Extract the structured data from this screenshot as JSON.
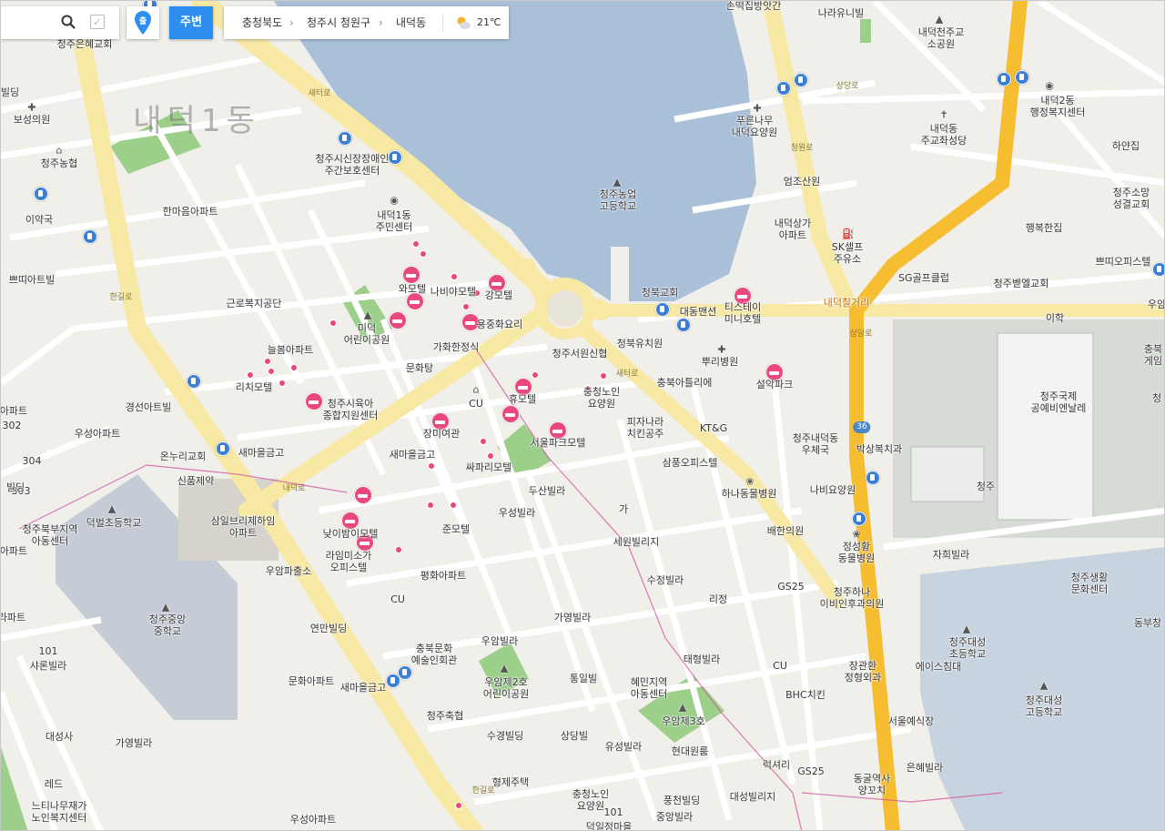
{
  "toolbar": {
    "search_icon": "search-icon",
    "checkbox_icon": "checkbox-icon",
    "pin_label": "출",
    "nearby_label": "주변",
    "breadcrumb": [
      "충청북도",
      "청주시 청원구",
      "내덕동"
    ],
    "weather_icon": "partly-cloudy-icon",
    "temperature": "21℃"
  },
  "colors": {
    "accent": "#2b8ef0",
    "motel": "#e8487e",
    "bus": "#3b7fd4",
    "highway": "#f5bd2f",
    "road_major": "#f7e9a4",
    "water": "#a9c0d8",
    "park": "#9bcf8a"
  },
  "labels": {
    "district": "내덕1동",
    "road_saetgol": "새터로",
    "road_hangul": "한길로",
    "road_naedeok": "내덕로",
    "road_cheongwon": "청원로",
    "road_sangdang": "상당로",
    "shield_36": "36",
    "cheongju_eunhye": "청주은혜교회",
    "sonteok": "손떡집방앗간",
    "narauni": "나라유니빌",
    "naedeok_cheonju_park": "내덕천주교\n소공원",
    "naedeok2_office": "내덕2동\n행정복지센터",
    "bilding": "빌딩",
    "boseong": "보성의원",
    "cheongju_nonghyup": "청주농협",
    "iyakguk": "이약국",
    "hanmaeum": "한마음아파트",
    "ppeotti": "쁘띠아트빌",
    "geunro": "근로복지공단",
    "neulbom": "늘봄아파트",
    "richi": "리치모텔",
    "gyeongseon": "경선아트빌",
    "woosung_apt": "우성아파트",
    "onnuri": "온누리교회",
    "sinpung": "신품제약",
    "saemaeul_bank1": "새마을금고",
    "a302": "302",
    "a304": "304",
    "a303": "303",
    "apt_a": "아파트",
    "bildeung": "빌딩",
    "cheongju_north_children": "청주북부지역\n아동센터",
    "deokbeol": "덕벌초등학교",
    "samil": "삼일브리제하임\n아파트",
    "uam_police": "우암파출소",
    "cheongju_middle": "청주중앙\n중학교",
    "yeonmyeon": "연만빌딩",
    "munhwa_apt": "문화아파트",
    "saemaeul_bank3": "새마을금고",
    "apt_b": "아파트",
    "sharon": "샤론빌라",
    "daeseongsa": "대성사",
    "gayeong1": "가영빌라",
    "red": "레드",
    "neutinamu": "느티나무재가\n노인복지센터",
    "cheongju_sinsijang": "청주시신장장애인\n주간보호센터",
    "naedeok1_center": "내덕1동\n주민센터",
    "wa_motel": "와모텔",
    "nabiya_motel": "나비야모텔",
    "gang_motel": "강모텔",
    "mideok_park": "미덕\n어린이공원",
    "yongjungwha": "용중화요리",
    "gahwa": "가화한정식",
    "munhwatang": "문화탕",
    "cheongju_siyuk": "청주시육아\n종합지원센터",
    "cu1": "CU",
    "hyu_motel": "휴모텔",
    "jangmi": "장미여관",
    "saemaeul_bank2": "새마을금고",
    "ssapari": "싸파리모텔",
    "seoul_park_motel": "서울파크모텔",
    "dusan": "두산빌라",
    "woosung_villa": "우성빌라",
    "nat_bam": "낮이밤이모텔",
    "jun_motel": "준모텔",
    "laim": "라임미소가\n오피스텔",
    "pyeonghwa": "평화아파트",
    "cu2": "CU",
    "chungbuk_culture": "충북문화\n예술인회관",
    "uam_villa": "우암빌라",
    "gayeong2": "가영빌라",
    "uamje2_park": "우암제2호\n어린이공원",
    "tongil": "통일빌",
    "cheongju_chukhyup": "청주축협",
    "sugyeong": "수경빌딩",
    "sangdang": "상당빌",
    "hyeongje": "형제주택",
    "chungcheong_care2": "충청노인\n요양원",
    "woosung_apt2": "우성아파트",
    "deokiljeongma": "덕일정마을",
    "a101": "101",
    "a101b": "101",
    "cheongju_nongup": "청주농업\n고등학교",
    "cheongbuk_church": "청북교회",
    "daedong": "대동맨션",
    "cheongju_seowon": "청주서원신협",
    "cheongbuk_kinder": "청북유치원",
    "chungcheong_care1": "충청노인\n요양원",
    "pizza_chicken": "피자나라\n치킨공주",
    "chungbuk_atelier": "충북아틀리에",
    "ktg": "KT&G",
    "samsung_office": "삼풍오피스텔",
    "seweon_villa": "세원빌리지",
    "gagyeong": "가",
    "sujeong": "수정빌라",
    "ri": "리정",
    "taehyeong": "태형빌라",
    "hyemin": "혜민지역\n아동센터",
    "uamje3": "우암제3호",
    "hyeondae": "현대원룸",
    "yuseong": "유성빌라",
    "pungcheon": "풍천빌딩",
    "jungang_villa": "중앙빌라",
    "daeseong_villiage": "대성빌리지",
    "lak": "럭셔리",
    "pureun": "푸른나무\n내덕요양원",
    "eomjo": "엄조산원",
    "naedeok_sangga": "내덕상가\n아파트",
    "sk_self": "SK셀프\n주유소",
    "sg_golf": "SG골프클럽",
    "naedeok_church": "내덕동\n주교좌성당",
    "haengbok": "행복한집",
    "hayan": "하얀집",
    "cheongju_soyang": "청주소망\n성결교회",
    "ppeotti_office": "쁘띠오피스텔",
    "cheongju_bethel": "청주벧엘교회",
    "ihak": "이학",
    "naedeok_chilgeori": "내덕칠거리",
    "tiseutei": "티스테이\n미니호텔",
    "ppuri": "뿌리병원",
    "seoul_park": "설악파크",
    "cheongju_naedeok_post": "청주내덕동\n우체국",
    "baksang": "박상복치과",
    "hana_animal": "하나동물병원",
    "nabi_care": "나비요양원",
    "baehan": "배한의원",
    "jeongseong_animal": "정성황\n동물병원",
    "jahui": "자희빌라",
    "gs25a": "GS25",
    "cheongju_hana": "청주하나\n이비인후과의원",
    "cu3": "CU",
    "janggwan": "장관환\n정형외과",
    "ace": "에이스침대",
    "bhc": "BHC치킨",
    "seoul_yesikjang": "서울예식장",
    "gs25b": "GS25",
    "donggul": "동굴역사\n양꼬치",
    "eunhye_villa": "은혜빌라",
    "cheongju_intl": "청주국제\n공예비엔날레",
    "cheongju": "청주",
    "cheongju_life": "청주생활\n문화센터",
    "cheongju_daeseong_elem": "청주대성\n초등학교",
    "cheongju_daeseong_high": "청주대성\n고등학교",
    "dongbu": "동부창",
    "chungbuk_r": "충북\n게임",
    "cheong_r": "청",
    "u_r": "우암",
    "gyeong_left": "아파트",
    "seoul_left": "라파트"
  }
}
